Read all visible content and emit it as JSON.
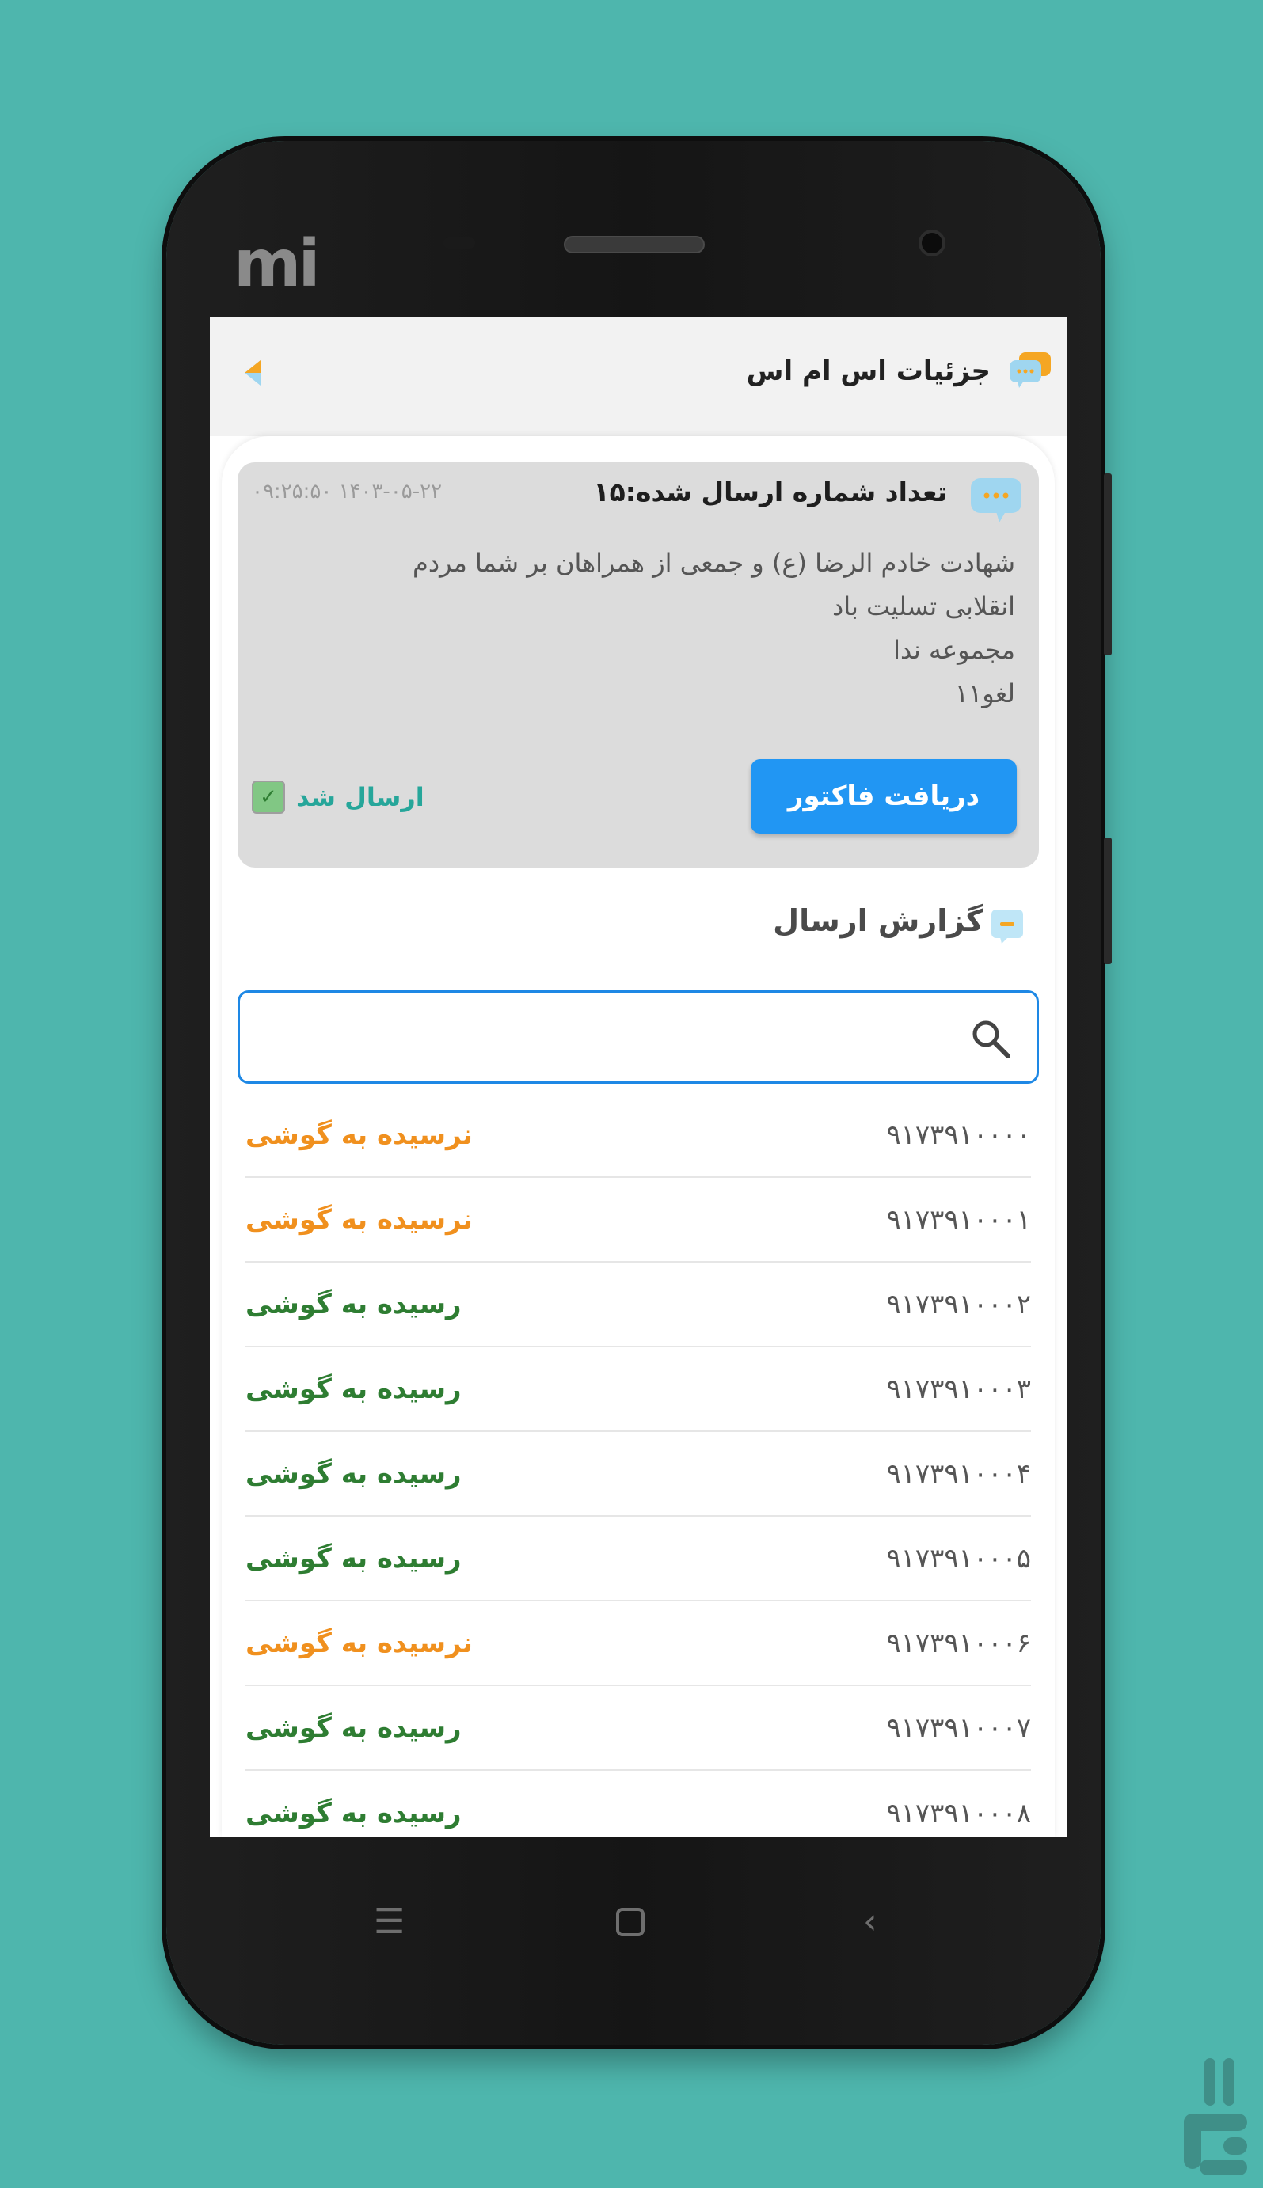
{
  "appbar": {
    "title": "جزئیات اس ام اس"
  },
  "card": {
    "count_label": "تعداد شماره ارسال شده:۱۵",
    "datetime": "۰۹:۲۵:۵۰ ۱۴۰۳-۰۵-۲۲",
    "message_lines": [
      "شهادت خادم الرضا (ع) و جمعی از همراهان بر شما مردم",
      "انقلابی تسلیت باد",
      "مجموعه ندا",
      "لغو۱۱"
    ],
    "invoice_button": "دریافت فاکتور",
    "sent_status": "ارسال شد"
  },
  "report": {
    "title": "گزارش ارسال"
  },
  "search": {
    "value": ""
  },
  "recipients": [
    {
      "number": "۹۱۷۳۹۱۰۰۰۰",
      "status": "نرسیده به گوشی",
      "delivered": false
    },
    {
      "number": "۹۱۷۳۹۱۰۰۰۱",
      "status": "نرسیده به گوشی",
      "delivered": false
    },
    {
      "number": "۹۱۷۳۹۱۰۰۰۲",
      "status": "رسیده به گوشی",
      "delivered": true
    },
    {
      "number": "۹۱۷۳۹۱۰۰۰۳",
      "status": "رسیده به گوشی",
      "delivered": true
    },
    {
      "number": "۹۱۷۳۹۱۰۰۰۴",
      "status": "رسیده به گوشی",
      "delivered": true
    },
    {
      "number": "۹۱۷۳۹۱۰۰۰۵",
      "status": "رسیده به گوشی",
      "delivered": true
    },
    {
      "number": "۹۱۷۳۹۱۰۰۰۶",
      "status": "نرسیده به گوشی",
      "delivered": false
    },
    {
      "number": "۹۱۷۳۹۱۰۰۰۷",
      "status": "رسیده به گوشی",
      "delivered": true
    },
    {
      "number": "۹۱۷۳۹۱۰۰۰۸",
      "status": "رسیده به گوشی",
      "delivered": true
    }
  ],
  "colors": {
    "background": "#4eb6ad",
    "accent_blue": "#2196f3",
    "delivered_green": "#2e7d32",
    "not_delivered_orange": "#f0901e",
    "sent_teal": "#26a69a"
  },
  "icons": {
    "appbar": "chat-bubbles-icon",
    "back": "back-arrow-icon",
    "card": "chat-bubble-icon",
    "report": "report-icon",
    "search": "search-icon",
    "check": "checkbox-checked-icon"
  }
}
